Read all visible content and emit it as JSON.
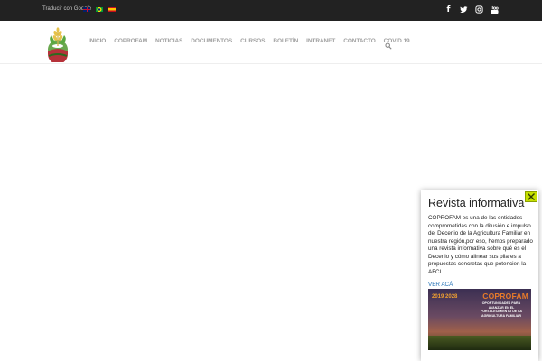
{
  "topbar": {
    "translate_label": "Traducir con Google",
    "flags": [
      "uk-flag",
      "brazil-flag",
      "spain-flag"
    ],
    "social_icons": [
      "facebook-icon",
      "twitter-icon",
      "instagram-icon",
      "youtube-icon"
    ]
  },
  "nav": {
    "items": [
      "INICIO",
      "COPROFAM",
      "NOTICIAS",
      "DOCUMENTOS",
      "CURSOS",
      "BOLETÍN",
      "INTRANET",
      "CONTACTO",
      "COVID 19"
    ],
    "search_icon": "search-icon"
  },
  "popup": {
    "title": "Revista informativa",
    "body": "COPROFAM es una de las entidades comprometidas con la difusión e impulso del Decenio de la Agricultura Familiar en nuestra región,por eso, hemos preparado una revista informativa sobre qué es el Decenio y cómo alinear sus pilares a propuestas concretas que potencien la AFCI.",
    "link_label": "VER ACÁ",
    "banner": {
      "brand": "COPROFAM",
      "subtitle": "OPORTUNIDADES PARA AVANZAR EN EL FORTALECIMIENTO DE LA AGRICULTURA FAMILIAR",
      "year": "2019 2028"
    },
    "close_icon": "close-icon"
  },
  "colors": {
    "topbar_bg": "#222222",
    "nav_text": "#a0a0a0",
    "close_bg": "#c6e000",
    "link": "#1f6fb5"
  }
}
